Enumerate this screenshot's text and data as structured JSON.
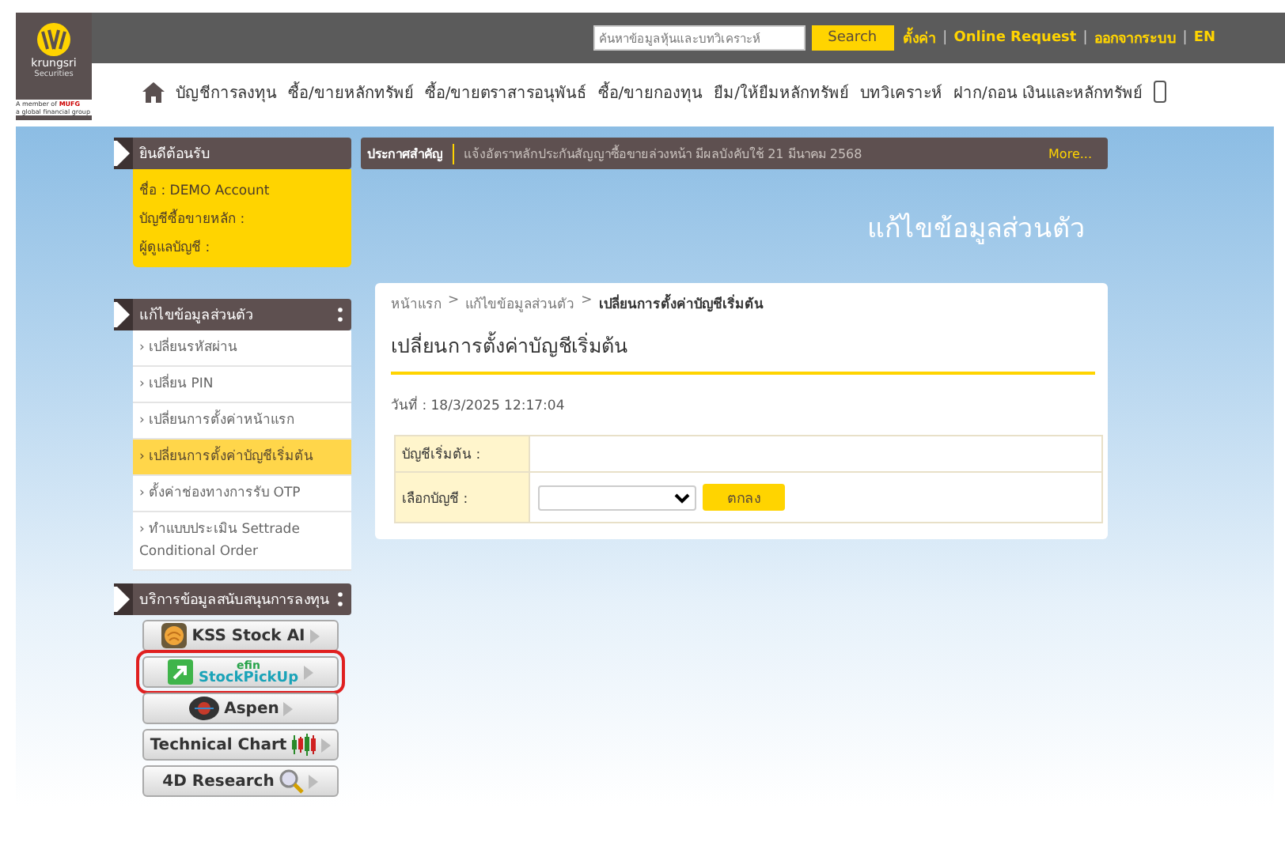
{
  "header": {
    "logo": {
      "name": "krungsri",
      "sub": "Securities",
      "member": "A member of",
      "mufg": "MUFG",
      "tagline": "a global financial group"
    },
    "search": {
      "placeholder": "ค้นหาข้อมูลหุ้นและบทวิเคราะห์",
      "button": "Search"
    },
    "links": [
      "ตั้งค่า",
      "Online Request",
      "ออกจากระบบ",
      "EN"
    ],
    "link_separator": "|"
  },
  "nav": [
    "บัญชีการลงทุน",
    "ซื้อ/ขายหลักทรัพย์",
    "ซื้อ/ขายตราสารอนุพันธ์",
    "ซื้อ/ขายกองทุน",
    "ยืม/ให้ยืมหลักทรัพย์",
    "บทวิเคราะห์",
    "ฝาก/ถอน เงินและหลักทรัพย์"
  ],
  "welcome": {
    "title": "ยินดีต้อนรับ",
    "lines": [
      "ชื่อ : DEMO Account",
      "บัญชีซื้อขายหลัก :",
      "ผู้ดูแลบัญชี :"
    ]
  },
  "announcement": {
    "label": "ประกาศสำคัญ",
    "text": "แจ้งอัตราหลักประกันสัญญาซื้อขายล่วงหน้า มีผลบังคับใช้ 21 มีนาคม 2568",
    "more": "More..."
  },
  "banner_title": "แก้ไขข้อมูลส่วนตัว",
  "profile_menu": {
    "title": "แก้ไขข้อมูลส่วนตัว",
    "items": [
      {
        "label": "› เปลี่ยนรหัสผ่าน",
        "selected": false
      },
      {
        "label": "› เปลี่ยน PIN",
        "selected": false
      },
      {
        "label": "› เปลี่ยนการตั้งค่าหน้าแรก",
        "selected": false
      },
      {
        "label": "› เปลี่ยนการตั้งค่าบัญชีเริ่มต้น",
        "selected": true
      },
      {
        "label": "› ตั้งค่าช่องทางการรับ OTP",
        "selected": false
      },
      {
        "label": "› ทำแบบประเมิน Settrade Conditional Order",
        "selected": false
      }
    ]
  },
  "services": {
    "title": "บริการข้อมูลสนับสนุนการลงทุน",
    "items": [
      {
        "kind": "stock-ai",
        "label": "KSS Stock AI",
        "highlighted": false
      },
      {
        "kind": "efin",
        "label": "efin",
        "label_2": "StockPickUp",
        "highlighted": true
      },
      {
        "kind": "aspen",
        "label": "Aspen",
        "highlighted": false
      },
      {
        "kind": "chart",
        "label": "Technical Chart",
        "highlighted": false
      },
      {
        "kind": "research",
        "label": "4D Research",
        "highlighted": false
      }
    ]
  },
  "content": {
    "breadcrumb": [
      "หน้าแรก",
      "แก้ไขข้อมูลส่วนตัว",
      "เปลี่ยนการตั้งค่าบัญชีเริ่มต้น"
    ],
    "breadcrumb_separator": ">",
    "title": "เปลี่ยนการตั้งค่าบัญชีเริ่มต้น",
    "date": "วันที่ : 18/3/2025 12:17:04",
    "form": [
      {
        "kind": "text",
        "label": "บัญชีเริ่มต้น :"
      },
      {
        "kind": "select",
        "label": "เลือกบัญชี :"
      }
    ],
    "submit": "ตกลง"
  }
}
